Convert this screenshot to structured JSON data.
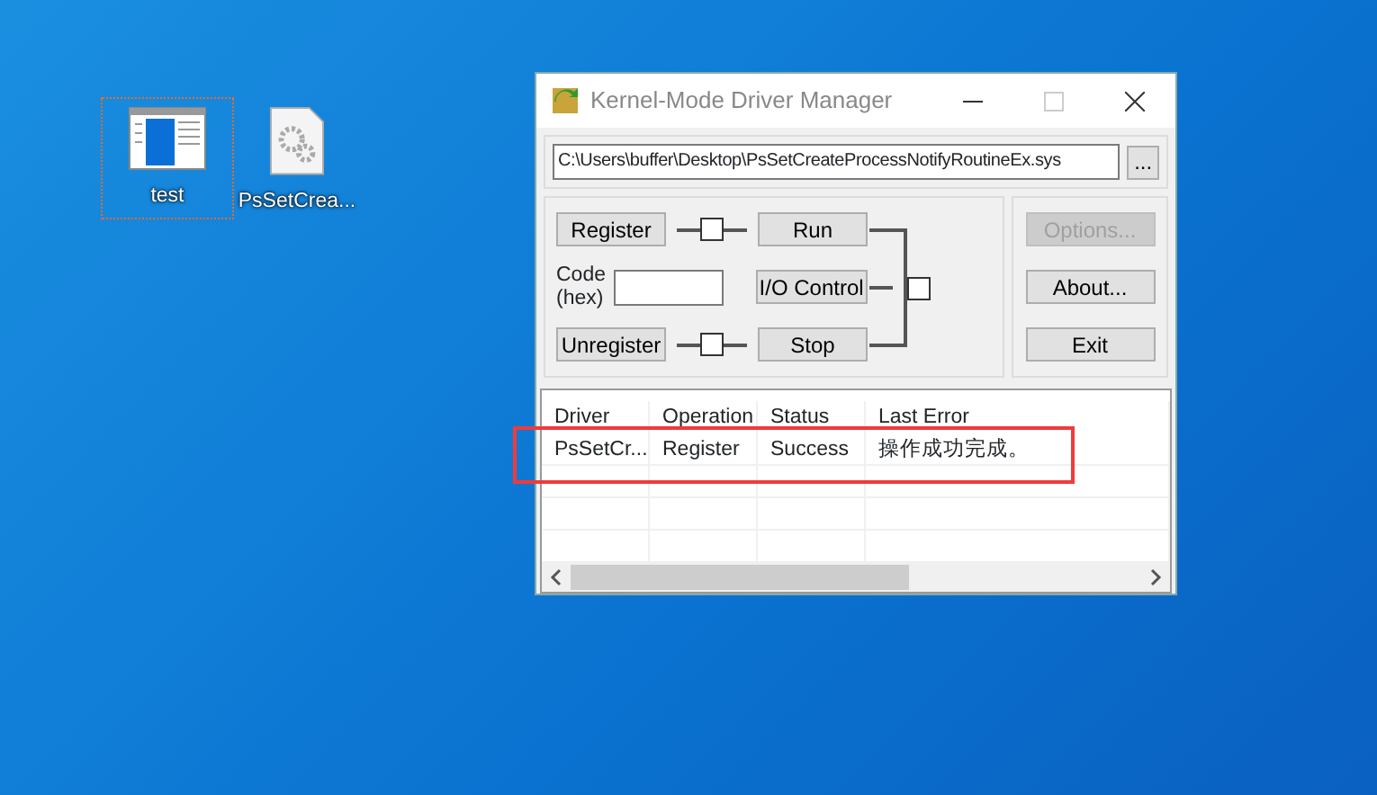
{
  "desktop_icons": [
    {
      "label": "test",
      "kind": "app",
      "selected": true
    },
    {
      "label": "PsSetCrea...",
      "kind": "file",
      "selected": false
    }
  ],
  "window": {
    "title": "Kernel-Mode Driver Manager",
    "path": "C:\\Users\\buffer\\Desktop\\PsSetCreateProcessNotifyRoutineEx.sys",
    "browse_button": "...",
    "register_button": "Register",
    "unregister_button": "Unregister",
    "code_label": "Code\n(hex)",
    "run_button": "Run",
    "io_control_button": "I/O Control",
    "stop_button": "Stop",
    "side_buttons": [
      {
        "label": "Options...",
        "disabled": true
      },
      {
        "label": "About...",
        "disabled": false
      },
      {
        "label": "Exit",
        "disabled": false
      }
    ],
    "table": {
      "columns": [
        "Driver",
        "Operation",
        "Status",
        "Last Error"
      ],
      "rows": [
        {
          "cells": [
            "PsSetCr...",
            "Register",
            "Success",
            "操作成功完成。"
          ],
          "highlighted": true
        }
      ]
    }
  }
}
